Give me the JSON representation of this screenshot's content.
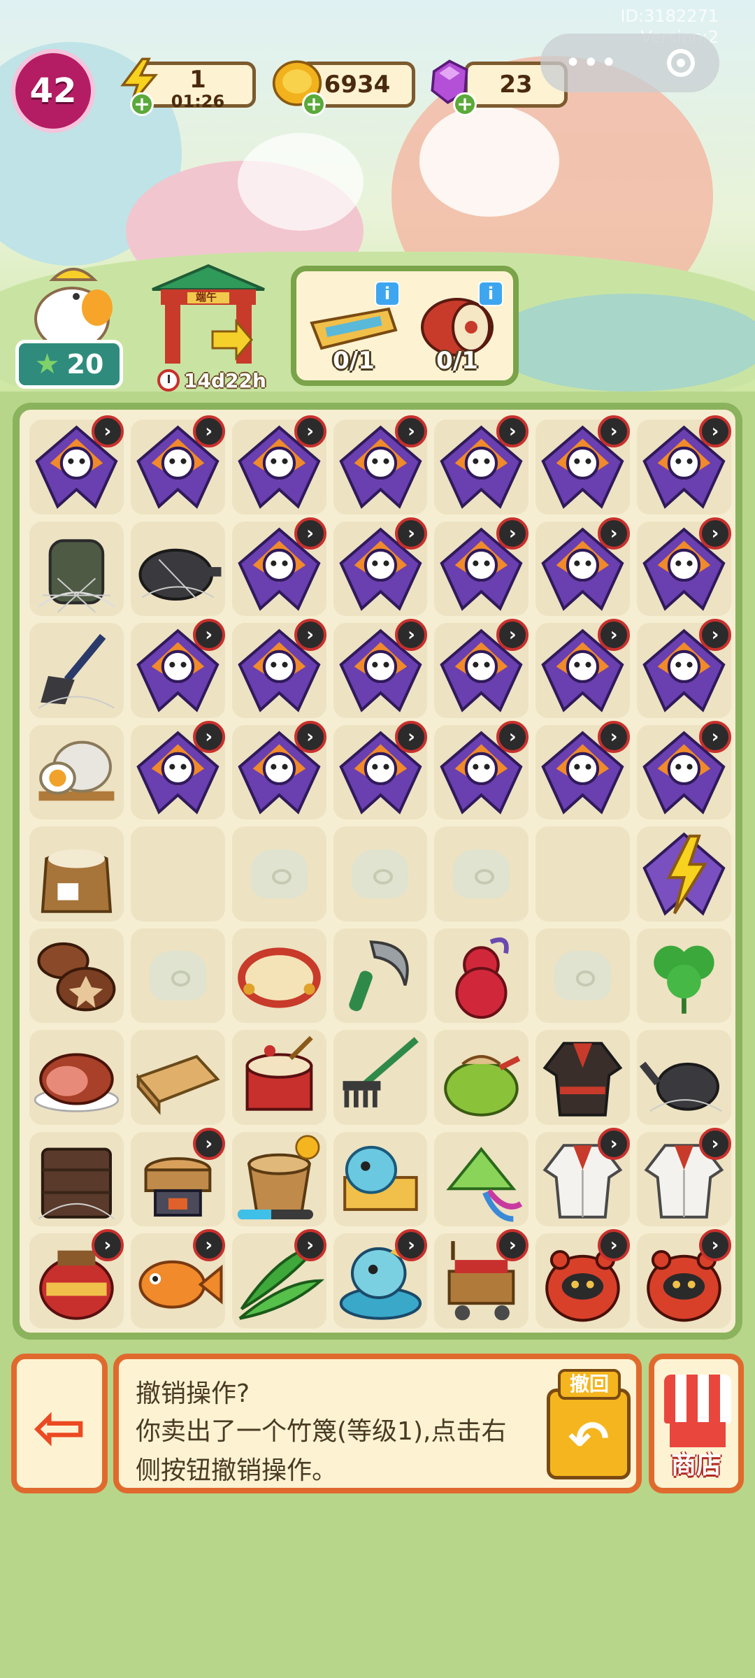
{
  "hud": {
    "level": "42",
    "energy": {
      "value": "1",
      "timer": "01:26",
      "icon": "lightning-icon"
    },
    "coins": {
      "value": "6934",
      "icon": "coin-icon"
    },
    "gems": {
      "value": "23",
      "icon": "gem-icon"
    },
    "id_text": "ID:3182271",
    "version_text": "Version:2"
  },
  "event": {
    "stars": "20",
    "gate_sign": "端午",
    "gate_timer": "14d22h",
    "orders": [
      {
        "name": "dragon-boat-order",
        "count": "0/1"
      },
      {
        "name": "drum-order",
        "count": "0/1"
      }
    ]
  },
  "board": {
    "rows": [
      [
        "kite",
        "kite",
        "kite",
        "kite",
        "kite",
        "kite",
        "kite"
      ],
      [
        "cobweb-backpack",
        "cobweb-pot",
        "kite",
        "kite",
        "kite",
        "kite",
        "kite"
      ],
      [
        "cobweb-shovel",
        "kite",
        "kite",
        "kite",
        "kite",
        "kite",
        "kite"
      ],
      [
        "salted-egg",
        "kite",
        "kite",
        "kite",
        "kite",
        "kite",
        "kite"
      ],
      [
        "rice-sack",
        "empty",
        "package",
        "package",
        "package",
        "empty",
        "lightning-kite"
      ],
      [
        "mushrooms",
        "package",
        "tambourine",
        "sickle",
        "red-gourd",
        "package",
        "herb"
      ],
      [
        "ham",
        "wood-log",
        "drum",
        "rake",
        "green-pouch",
        "robe",
        "cobweb-kettle"
      ],
      [
        "cobweb-box",
        "steamer",
        "rice-bucket",
        "dragon-boat-box",
        "zongzi-sachet",
        "white-robe",
        "white-robe"
      ],
      [
        "wine-jar",
        "koi-fish",
        "bamboo-leaves",
        "dragon-boat-head",
        "market-cart",
        "tiger-pouch",
        "tiger-pouch"
      ]
    ],
    "locked": [
      [
        1,
        1,
        1,
        1,
        1,
        1,
        1
      ],
      [
        0,
        0,
        1,
        1,
        1,
        1,
        1
      ],
      [
        0,
        1,
        1,
        1,
        1,
        1,
        1
      ],
      [
        0,
        1,
        1,
        1,
        1,
        1,
        1
      ],
      [
        0,
        0,
        0,
        0,
        0,
        0,
        0
      ],
      [
        0,
        0,
        0,
        0,
        0,
        0,
        0
      ],
      [
        0,
        0,
        0,
        0,
        0,
        0,
        0
      ],
      [
        0,
        1,
        0,
        0,
        0,
        1,
        1
      ],
      [
        1,
        1,
        1,
        1,
        1,
        1,
        1
      ]
    ],
    "rice_bucket_progress": 0.45
  },
  "bottom": {
    "msg_title": "撤销操作?",
    "msg_body": "你卖出了一个竹篾(等级1),点击右侧按钮撤销操作。",
    "undo_label": "撤回",
    "shop_label": "商店"
  },
  "colors": {
    "board_border": "#8bb25c",
    "accent_orange": "#e06a2e",
    "level_pink": "#b41c63"
  }
}
